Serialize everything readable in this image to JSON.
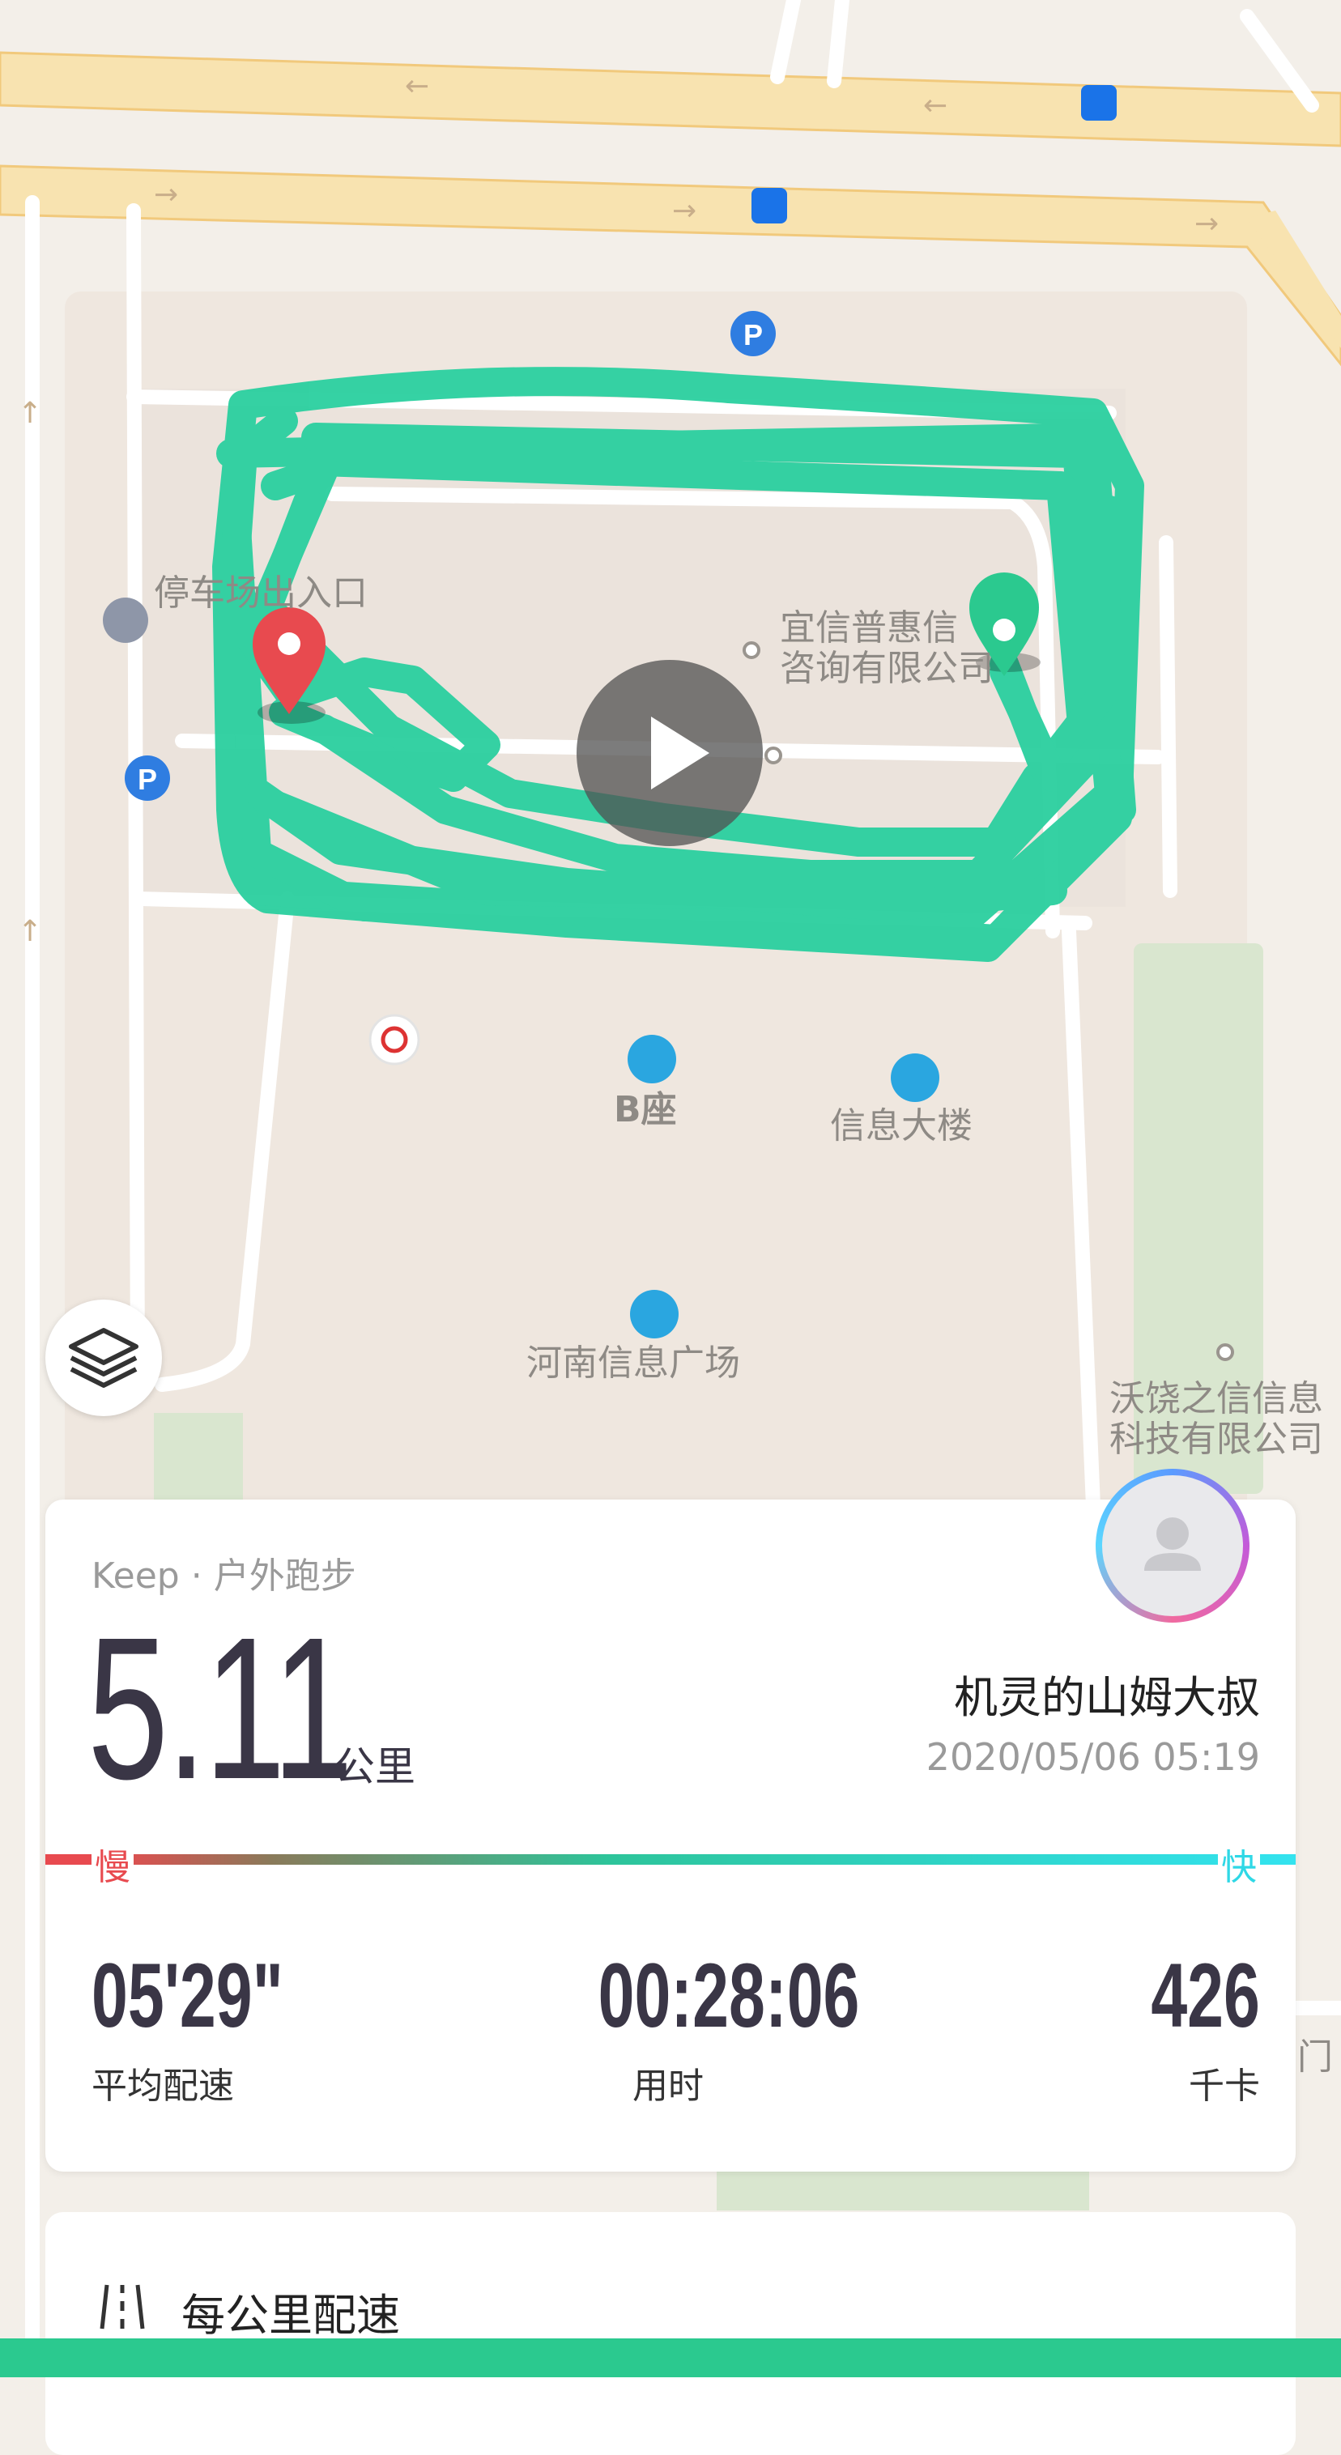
{
  "map": {
    "labels": {
      "parking_exit": "停车场出入口",
      "yixin_line1": "宜信普惠信",
      "yixin_line2": "咨询有限公司",
      "building_b": "B座",
      "info_building": "信息大楼",
      "henan_plaza": "河南信息广场",
      "woyao_line1": "沃饶之信信息",
      "woyao_line2": "科技有限公司",
      "right_edge_text": "门"
    },
    "route_color": "#2dd0a0",
    "start_marker_color": "#e84a4f",
    "end_marker_color": "#2bc98f"
  },
  "summary": {
    "source": "Keep · 户外跑步",
    "distance_value": "5.11",
    "distance_unit": "公里",
    "user_name": "机灵的山姆大叔",
    "datetime": "2020/05/06 05:19",
    "slow_label": "慢",
    "fast_label": "快",
    "stats": {
      "pace_value": "05'29\"",
      "pace_label": "平均配速",
      "duration_value": "00:28:06",
      "duration_label": "用时",
      "calories_value": "426",
      "calories_label": "千卡"
    }
  },
  "per_km": {
    "title": "每公里配速"
  },
  "colors": {
    "accent_green": "#2bc98f",
    "slow_red": "#e84a4f",
    "fast_cyan": "#33e3ef"
  }
}
